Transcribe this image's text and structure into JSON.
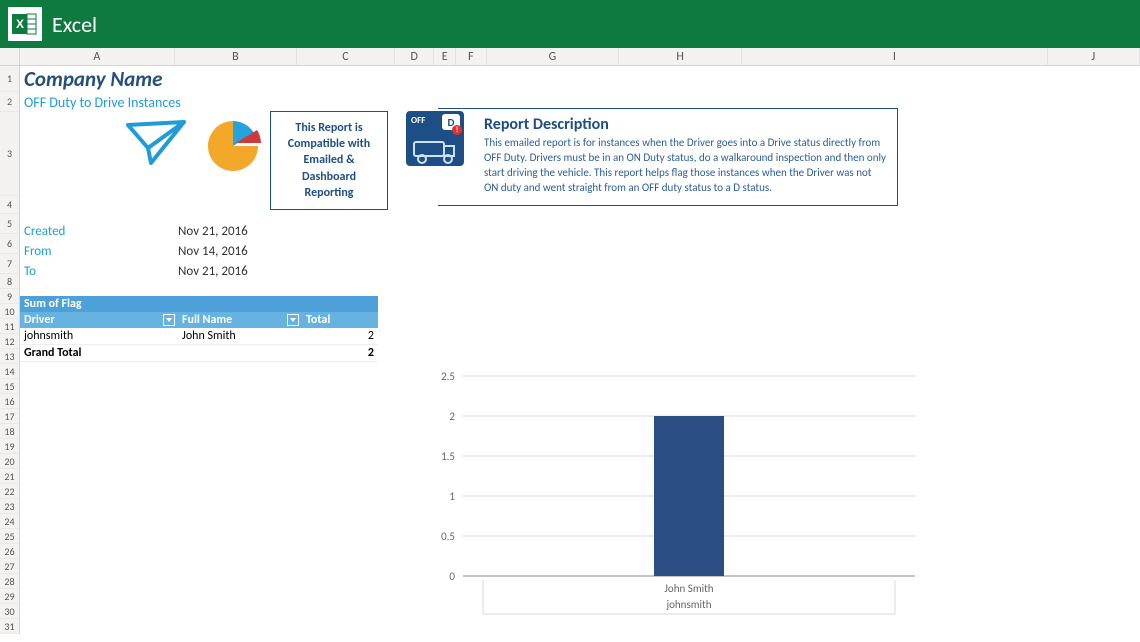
{
  "app": {
    "name": "Excel"
  },
  "columns": [
    "A",
    "B",
    "C",
    "D",
    "E",
    "F",
    "G",
    "H",
    "I",
    "J"
  ],
  "rows": [
    "1",
    "2",
    "3",
    "4",
    "5",
    "6",
    "7",
    "8",
    "9",
    "10",
    "11",
    "12",
    "13",
    "14",
    "15",
    "16",
    "17",
    "18",
    "19",
    "20",
    "21",
    "22",
    "23",
    "24",
    "25",
    "26",
    "27",
    "28",
    "29",
    "30",
    "31"
  ],
  "header": {
    "company": "Company Name",
    "subtitle": "OFF Duty to Drive Instances",
    "compat": "This Report is Compatible with Emailed & Dashboard Reporting"
  },
  "description": {
    "title": "Report Description",
    "body": "This emailed report is for instances when the Driver goes into a Drive status directly from OFF Duty. Drivers must be in an ON Duty status, do a walkaround inspection and then only start driving the vehicle. This report helps flag those instances when the Driver was not ON duty and went straight from an OFF duty status to a D status.",
    "badge_off": "OFF",
    "badge_d": "D"
  },
  "meta": {
    "label_created": "Created",
    "val_created": "Nov 21, 2016",
    "label_from": "From",
    "val_from": "Nov 14, 2016",
    "label_to": "To",
    "val_to": "Nov 21, 2016"
  },
  "pivot": {
    "sum_label": "Sum of Flag",
    "col_driver": "Driver",
    "col_fullname": "Full Name",
    "col_total": "Total",
    "rows": [
      {
        "driver": "johnsmith",
        "fullname": "John Smith",
        "total": "2"
      }
    ],
    "grand_label": "Grand Total",
    "grand_total": "2"
  },
  "chart_data": {
    "type": "bar",
    "categories": [
      "John Smith"
    ],
    "sub_categories": [
      "johnsmith"
    ],
    "values": [
      2
    ],
    "ylim": [
      0,
      2.5
    ],
    "yticks": [
      0,
      0.5,
      1,
      1.5,
      2,
      2.5
    ],
    "title": "",
    "xlabel": "",
    "ylabel": ""
  }
}
